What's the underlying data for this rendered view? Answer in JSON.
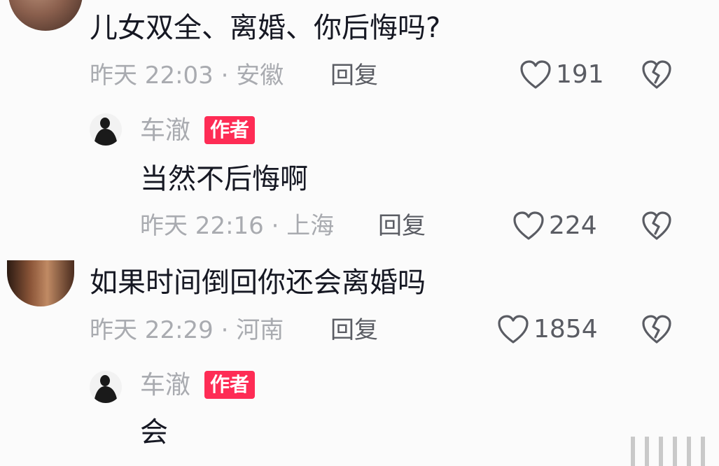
{
  "colors": {
    "background": "#fbfbfb",
    "text": "#161823",
    "meta": "#a9abb0",
    "action": "#5a5c63",
    "author_badge": "#fe2c55"
  },
  "comments": [
    {
      "text": "儿女双全、离婚、你后悔吗?",
      "meta": "昨天 22:03 · 安徽",
      "reply_label": "回复",
      "likes": "191",
      "avatar_icon": "user-avatar-icon",
      "like_icon": "heart-outline-icon",
      "dislike_icon": "broken-heart-icon",
      "reply": {
        "name": "车澈",
        "badge": "作者",
        "text": "当然不后悔啊",
        "meta": "昨天 22:16 · 上海",
        "reply_label": "回复",
        "likes": "224"
      }
    },
    {
      "text": "如果时间倒回你还会离婚吗",
      "meta": "昨天 22:29 · 河南",
      "reply_label": "回复",
      "likes": "1854",
      "avatar_icon": "user-avatar-icon",
      "like_icon": "heart-outline-icon",
      "dislike_icon": "broken-heart-icon",
      "reply": {
        "name": "车澈",
        "badge": "作者",
        "text": "会"
      }
    }
  ]
}
